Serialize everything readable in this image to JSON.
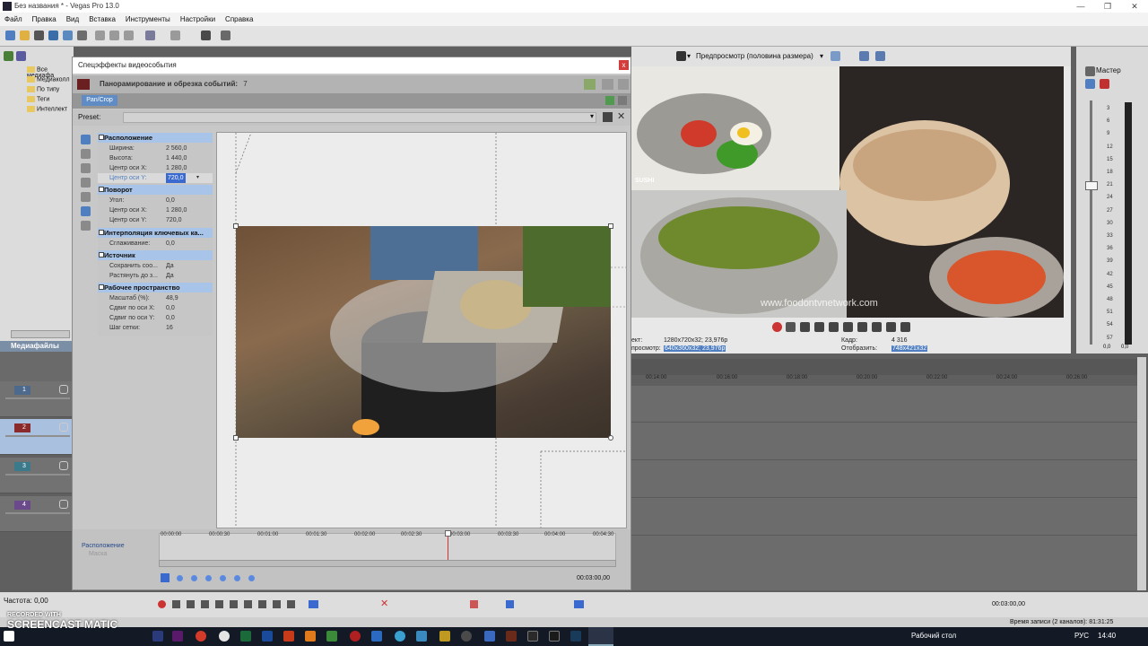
{
  "window": {
    "title": "Без названия * - Vegas Pro 13.0"
  },
  "menu": [
    "Файл",
    "Правка",
    "Вид",
    "Вставка",
    "Инструменты",
    "Настройки",
    "Справка"
  ],
  "media_tree": [
    "Все медиафа",
    "Медиаколл",
    "По типу",
    "Теги",
    "Интеллект"
  ],
  "media_tab_label": "Медиафайлы про",
  "tracks": [
    "1",
    "2",
    "3",
    "4"
  ],
  "dialog": {
    "title": "Спецэффекты видеособытия",
    "close": "x",
    "fx_header": "Панорамирование и обрезка событий:",
    "fx_count": "7",
    "pan_tab": "Pan/Crop",
    "preset_label": "Preset:",
    "sections": {
      "position": "Расположение",
      "rotation": "Поворот",
      "interp": "Интерполяция ключевых ка...",
      "source": "Источник",
      "workspace": "Рабочее пространство"
    },
    "props": {
      "width_lbl": "Ширина:",
      "width_val": "2 560,0",
      "height_lbl": "Высота:",
      "height_val": "1 440,0",
      "cx_lbl": "Центр оси X:",
      "cx_val": "1 280,0",
      "cy_lbl": "Центр оси Y:",
      "cy_val": "720,0",
      "angle_lbl": "Угол:",
      "angle_val": "0,0",
      "rcx_lbl": "Центр оси X:",
      "rcx_val": "1 280,0",
      "rcy_lbl": "Центр оси Y:",
      "rcy_val": "720,0",
      "smooth_lbl": "Сглаживание:",
      "smooth_val": "0,0",
      "keep_lbl": "Сохранить соо...",
      "keep_val": "Да",
      "stretch_lbl": "Растянуть до з...",
      "stretch_val": "Да",
      "scale_lbl": "Масштаб (%):",
      "scale_val": "48,9",
      "shiftx_lbl": "Сдвиг по оси X:",
      "shiftx_val": "0,0",
      "shifty_lbl": "Сдвиг по оси Y:",
      "shifty_val": "0,0",
      "grid_lbl": "Шаг сетки:",
      "grid_val": "16"
    },
    "kf_ruler": [
      "00:00:00",
      "00:00:30",
      "00:01:00",
      "00:01:30",
      "00:02:00",
      "00:02:30",
      "00:03:00",
      "00:03:30",
      "00:04:00",
      "00:04:30"
    ],
    "kf_track_label": "Расположение",
    "kf_mask_label": "Маска",
    "kf_time": "00:03:00,00"
  },
  "preview": {
    "mode": "Предпросмотр (половина размера)",
    "watermark": "www.foodontvnetwork.com",
    "logo": "SUSHI",
    "info_project_lbl": "ект:",
    "info_project_val": "1280x720x32; 23,976p",
    "info_preview_lbl": "просмотр:",
    "info_preview_val": "640x360x32; 23,976p",
    "info_frame_lbl": "Кадр:",
    "info_frame_val": "4 316",
    "info_display_lbl": "Отобразить:",
    "info_display_val": "748x421x32"
  },
  "master": {
    "label": "Мастер",
    "scale": [
      "3",
      "6",
      "9",
      "12",
      "15",
      "18",
      "21",
      "24",
      "27",
      "30",
      "33",
      "36",
      "39",
      "42",
      "45",
      "48",
      "51",
      "54",
      "57"
    ],
    "bottom": [
      "0,0",
      "0,0"
    ]
  },
  "timeline_ruler": [
    "00:14:00",
    "00:16:00",
    "00:18:00",
    "00:20:00",
    "00:22:00",
    "00:24:00",
    "00:26:00"
  ],
  "transport": {
    "rate": "Частота: 0,00",
    "time": "00:03:00,00"
  },
  "status": {
    "record_time": "Время записи (2 каналов): 81:31:25"
  },
  "taskbar": {
    "desktop": "Рабочий стол",
    "lang": "РУС",
    "clock": "14:40"
  },
  "watermark": {
    "line1": "RECORDED WITH",
    "line2": "SCREENCAST",
    "line3": "MATIC"
  }
}
